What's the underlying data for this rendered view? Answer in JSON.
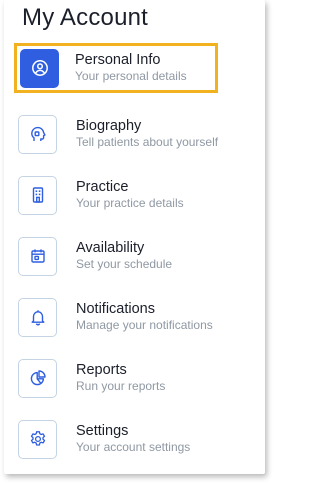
{
  "page": {
    "title": "My Account"
  },
  "menu": {
    "items": [
      {
        "label": "Personal Info",
        "sub": "Your personal details",
        "icon": "user-circle-icon",
        "selected": true
      },
      {
        "label": "Biography",
        "sub": "Tell patients about yourself",
        "icon": "head-icon"
      },
      {
        "label": "Practice",
        "sub": "Your practice details",
        "icon": "building-icon"
      },
      {
        "label": "Availability",
        "sub": "Set your schedule",
        "icon": "calendar-icon"
      },
      {
        "label": "Notifications",
        "sub": "Manage your notifications",
        "icon": "bell-icon"
      },
      {
        "label": "Reports",
        "sub": "Run your reports",
        "icon": "pie-chart-icon"
      },
      {
        "label": "Settings",
        "sub": "Your account settings",
        "icon": "gear-icon"
      }
    ]
  },
  "colors": {
    "accent": "#2f5fe0",
    "highlight": "#f2b21f",
    "icon_stroke": "#2f5fe0",
    "icon_border": "#c4d4e4"
  }
}
